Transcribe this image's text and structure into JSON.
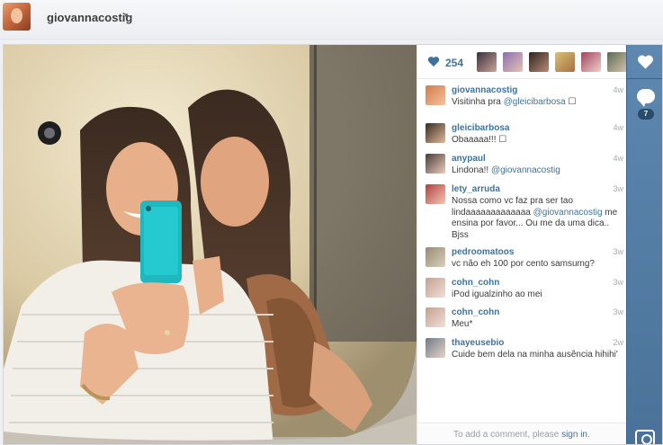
{
  "header": {
    "username": "giovannacostig",
    "caret": "▾"
  },
  "post": {
    "likes_count": "254",
    "likers": [
      {
        "color_a": "#3b2f3a",
        "color_b": "#c9a39a"
      },
      {
        "color_a": "#8b6fb2",
        "color_b": "#e5c3b0"
      },
      {
        "color_a": "#2e2420",
        "color_b": "#b98a73"
      },
      {
        "color_a": "#d8c07a",
        "color_b": "#a8703f"
      },
      {
        "color_a": "#a04560",
        "color_b": "#f0d0c8"
      },
      {
        "color_a": "#5a6b52",
        "color_b": "#d9c3ad"
      }
    ],
    "comment_count_badge": "7",
    "add_comment": {
      "prefix": "To add a comment, please",
      "link": "sign in",
      "suffix": "."
    }
  },
  "comments": [
    {
      "user": "giovannacostig",
      "time": "4w",
      "text": "Visitinha pra ",
      "mention": "@gleicibarbosa",
      "after": " ☐",
      "avatar_a": "#d47a4a",
      "avatar_b": "#f2c39f"
    },
    {
      "user": "gleicibarbosa",
      "time": "4w",
      "text": "Obaaaaa!!! ☐",
      "mention": "",
      "after": "",
      "avatar_a": "#3a2a22",
      "avatar_b": "#e3b89a"
    },
    {
      "user": "anypaul",
      "time": "4w",
      "text": "Lindona!! ",
      "mention": "@giovannacostig",
      "after": "",
      "avatar_a": "#4a3a36",
      "avatar_b": "#e9cdbd"
    },
    {
      "user": "lety_arruda",
      "time": "3w",
      "text": "Nossa como vc faz pra ser tao lindaaaaaaaaaaaaa ",
      "mention": "@giovannacostig",
      "after": " me ensina por favor... Ou me da uma dica.. Bjss",
      "avatar_a": "#b04040",
      "avatar_b": "#f3c7b4"
    },
    {
      "user": "pedroomatoos",
      "time": "3w",
      "text": "vc não eh 100 por cento samsumg?",
      "mention": "",
      "after": "",
      "avatar_a": "#9a8a70",
      "avatar_b": "#d8d0c0"
    },
    {
      "user": "cohn_cohn",
      "time": "3w",
      "text": "iPod igualzinho ao mei",
      "mention": "",
      "after": "",
      "avatar_a": "#c5a090",
      "avatar_b": "#efe0d8"
    },
    {
      "user": "cohn_cohn",
      "time": "3w",
      "text": "Meu*",
      "mention": "",
      "after": "",
      "avatar_a": "#c5a090",
      "avatar_b": "#efe0d8"
    },
    {
      "user": "thayeusebio",
      "time": "2w",
      "text": "Cuide bem dela na minha ausência hihihi'",
      "mention": "",
      "after": "",
      "avatar_a": "#6d7b8a",
      "avatar_b": "#e8d3c6"
    }
  ]
}
